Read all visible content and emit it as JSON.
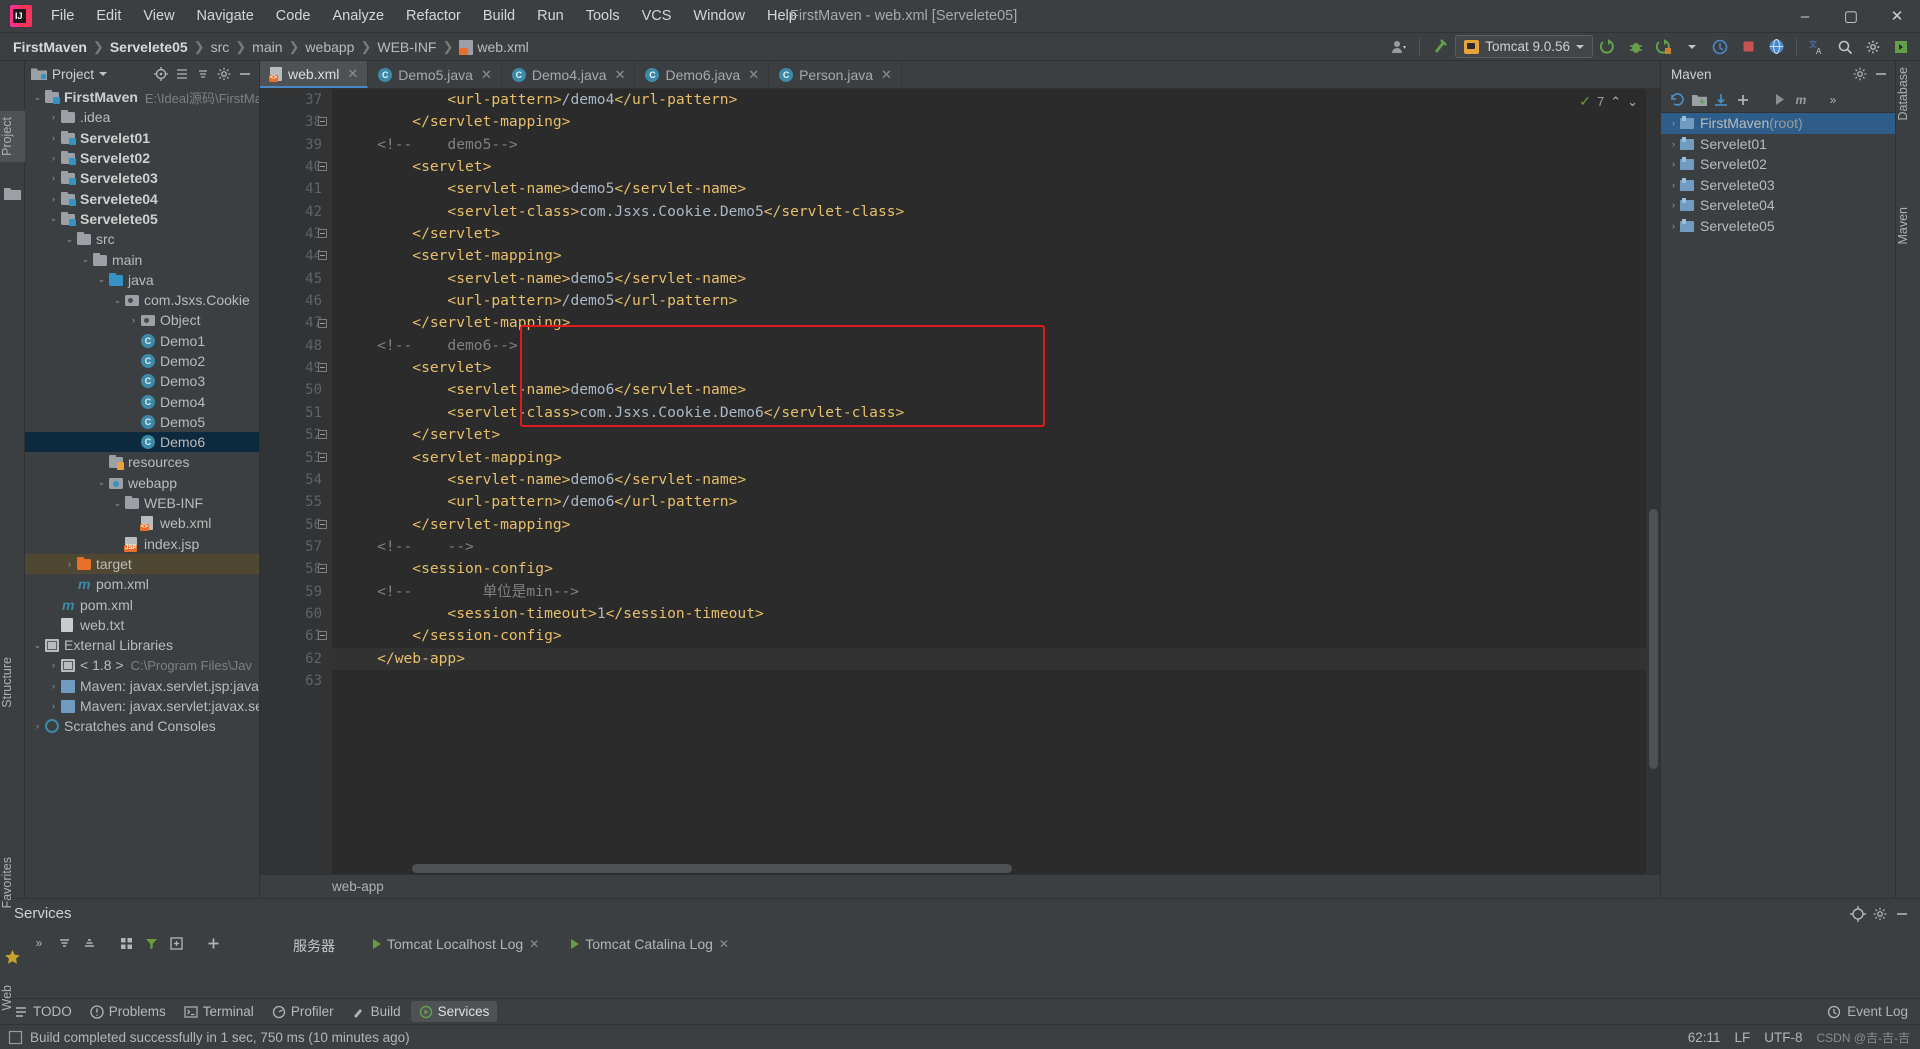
{
  "window": {
    "title": "FirstMaven - web.xml [Servelete05]",
    "minimize": "–",
    "maximize": "▢",
    "close": "✕"
  },
  "menu": {
    "items": [
      "File",
      "Edit",
      "View",
      "Navigate",
      "Code",
      "Analyze",
      "Refactor",
      "Build",
      "Run",
      "Tools",
      "VCS",
      "Window",
      "Help"
    ]
  },
  "navbar": {
    "crumbs": [
      "FirstMaven",
      "Servelete05",
      "src",
      "main",
      "webapp",
      "WEB-INF",
      "web.xml"
    ],
    "run_config": "Tomcat 9.0.56",
    "icons": {
      "profile": "profile-icon",
      "hammer": "build-hammer-icon",
      "run": "run-icon",
      "debug": "debug-icon",
      "run_with_coverage": "coverage-icon",
      "stop": "stop-icon",
      "updates": "updates-icon",
      "translate": "translate-icon",
      "search": "search-icon",
      "settings": "settings-gear-icon",
      "ide_search": "ide-search-icon"
    }
  },
  "left_rail": {
    "top": "Project",
    "middle": "Structure",
    "bottom": "Favorites",
    "web": "Web"
  },
  "right_rail": {
    "top": "Database",
    "bottom": "Maven"
  },
  "project_panel": {
    "title": "Project",
    "actions": [
      "collapse-icon",
      "sort-icon",
      "target-icon",
      "settings-icon",
      "hide-icon"
    ],
    "tree": [
      {
        "depth": 0,
        "arrow": "⌄",
        "icon": "module-folder",
        "label": "FirstMaven",
        "bold": true,
        "sub": "E:\\Ideal源码\\FirstMa"
      },
      {
        "depth": 1,
        "arrow": "›",
        "icon": "folder",
        "label": ".idea",
        "bold": false,
        "sub": ""
      },
      {
        "depth": 1,
        "arrow": "›",
        "icon": "module-folder",
        "label": "Servelet01",
        "bold": true,
        "sub": ""
      },
      {
        "depth": 1,
        "arrow": "›",
        "icon": "module-folder",
        "label": "Servelet02",
        "bold": true,
        "sub": ""
      },
      {
        "depth": 1,
        "arrow": "›",
        "icon": "module-folder",
        "label": "Servelete03",
        "bold": true,
        "sub": ""
      },
      {
        "depth": 1,
        "arrow": "›",
        "icon": "module-folder",
        "label": "Servelete04",
        "bold": true,
        "sub": ""
      },
      {
        "depth": 1,
        "arrow": "⌄",
        "icon": "module-folder",
        "label": "Servelete05",
        "bold": true,
        "sub": ""
      },
      {
        "depth": 2,
        "arrow": "⌄",
        "icon": "folder",
        "label": "src",
        "bold": false,
        "sub": ""
      },
      {
        "depth": 3,
        "arrow": "⌄",
        "icon": "folder",
        "label": "main",
        "bold": false,
        "sub": ""
      },
      {
        "depth": 4,
        "arrow": "⌄",
        "icon": "source-folder",
        "label": "java",
        "bold": false,
        "sub": ""
      },
      {
        "depth": 5,
        "arrow": "⌄",
        "icon": "package",
        "label": "com.Jsxs.Cookie",
        "bold": false,
        "sub": ""
      },
      {
        "depth": 6,
        "arrow": "›",
        "icon": "package",
        "label": "Object",
        "bold": false,
        "sub": ""
      },
      {
        "depth": 6,
        "arrow": "",
        "icon": "class",
        "label": "Demo1",
        "bold": false,
        "sub": ""
      },
      {
        "depth": 6,
        "arrow": "",
        "icon": "class",
        "label": "Demo2",
        "bold": false,
        "sub": ""
      },
      {
        "depth": 6,
        "arrow": "",
        "icon": "class",
        "label": "Demo3",
        "bold": false,
        "sub": ""
      },
      {
        "depth": 6,
        "arrow": "",
        "icon": "class",
        "label": "Demo4",
        "bold": false,
        "sub": ""
      },
      {
        "depth": 6,
        "arrow": "",
        "icon": "class",
        "label": "Demo5",
        "bold": false,
        "sub": ""
      },
      {
        "depth": 6,
        "arrow": "",
        "icon": "class",
        "label": "Demo6",
        "bold": false,
        "sub": "",
        "state": "selected"
      },
      {
        "depth": 4,
        "arrow": "",
        "icon": "resources-folder",
        "label": "resources",
        "bold": false,
        "sub": ""
      },
      {
        "depth": 4,
        "arrow": "⌄",
        "icon": "web-folder",
        "label": "webapp",
        "bold": false,
        "sub": ""
      },
      {
        "depth": 5,
        "arrow": "⌄",
        "icon": "folder",
        "label": "WEB-INF",
        "bold": false,
        "sub": ""
      },
      {
        "depth": 6,
        "arrow": "",
        "icon": "xml-file",
        "label": "web.xml",
        "bold": false,
        "sub": ""
      },
      {
        "depth": 5,
        "arrow": "",
        "icon": "jsp-file",
        "label": "index.jsp",
        "bold": false,
        "sub": ""
      },
      {
        "depth": 2,
        "arrow": "›",
        "icon": "excluded-folder",
        "label": "target",
        "bold": false,
        "sub": "",
        "state": "target-hl"
      },
      {
        "depth": 2,
        "arrow": "",
        "icon": "maven-file",
        "label": "pom.xml",
        "bold": false,
        "sub": ""
      },
      {
        "depth": 1,
        "arrow": "",
        "icon": "maven-file",
        "label": "pom.xml",
        "bold": false,
        "sub": ""
      },
      {
        "depth": 1,
        "arrow": "",
        "icon": "text-file",
        "label": "web.txt",
        "bold": false,
        "sub": ""
      },
      {
        "depth": 0,
        "arrow": "⌄",
        "icon": "library",
        "label": "External Libraries",
        "bold": false,
        "sub": ""
      },
      {
        "depth": 1,
        "arrow": "›",
        "icon": "jdk",
        "label": "< 1.8 >",
        "bold": false,
        "sub": "C:\\Program Files\\Jav"
      },
      {
        "depth": 1,
        "arrow": "›",
        "icon": "jar",
        "label": "Maven: javax.servlet.jsp:javax",
        "bold": false,
        "sub": ""
      },
      {
        "depth": 1,
        "arrow": "›",
        "icon": "jar",
        "label": "Maven: javax.servlet:javax.ser",
        "bold": false,
        "sub": ""
      },
      {
        "depth": 0,
        "arrow": "›",
        "icon": "scratches",
        "label": "Scratches and Consoles",
        "bold": false,
        "sub": ""
      }
    ]
  },
  "editor": {
    "tabs": [
      {
        "label": "web.xml",
        "icon": "xml-file-icon",
        "active": true
      },
      {
        "label": "Demo5.java",
        "icon": "java-class-icon",
        "active": false
      },
      {
        "label": "Demo4.java",
        "icon": "java-class-icon",
        "active": false
      },
      {
        "label": "Demo6.java",
        "icon": "java-class-icon",
        "active": false
      },
      {
        "label": "Person.java",
        "icon": "java-class-icon",
        "active": false
      }
    ],
    "inspection": {
      "warnings": "7",
      "check": "✓"
    },
    "first_line_number": 37,
    "lines": [
      {
        "n": 37,
        "indent": 0,
        "segs": [
          {
            "c": "t",
            "s": "            <url-pattern>"
          },
          {
            "c": "v",
            "s": "/demo4"
          },
          {
            "c": "t",
            "s": "</url-pattern>"
          }
        ]
      },
      {
        "n": 38,
        "indent": 0,
        "segs": [
          {
            "c": "t",
            "s": "        </servlet-mapping>"
          }
        ]
      },
      {
        "n": 39,
        "indent": 0,
        "segs": [
          {
            "c": "cm",
            "s": "    <!--    demo5-->"
          }
        ]
      },
      {
        "n": 40,
        "indent": 0,
        "segs": [
          {
            "c": "t",
            "s": "        <servlet>"
          }
        ]
      },
      {
        "n": 41,
        "indent": 0,
        "segs": [
          {
            "c": "t",
            "s": "            <servlet-name>"
          },
          {
            "c": "v",
            "s": "demo5"
          },
          {
            "c": "t",
            "s": "</servlet-name>"
          }
        ]
      },
      {
        "n": 42,
        "indent": 0,
        "segs": [
          {
            "c": "t",
            "s": "            <servlet-class>"
          },
          {
            "c": "v",
            "s": "com.Jsxs.Cookie.Demo5"
          },
          {
            "c": "t",
            "s": "</servlet-class>"
          }
        ]
      },
      {
        "n": 43,
        "indent": 0,
        "segs": [
          {
            "c": "t",
            "s": "        </servlet>"
          }
        ]
      },
      {
        "n": 44,
        "indent": 0,
        "segs": [
          {
            "c": "t",
            "s": "        <servlet-mapping>"
          }
        ]
      },
      {
        "n": 45,
        "indent": 0,
        "segs": [
          {
            "c": "t",
            "s": "            <servlet-name>"
          },
          {
            "c": "v",
            "s": "demo5"
          },
          {
            "c": "t",
            "s": "</servlet-name>"
          }
        ]
      },
      {
        "n": 46,
        "indent": 0,
        "segs": [
          {
            "c": "t",
            "s": "            <url-pattern>"
          },
          {
            "c": "v",
            "s": "/demo5"
          },
          {
            "c": "t",
            "s": "</url-pattern>"
          }
        ]
      },
      {
        "n": 47,
        "indent": 0,
        "segs": [
          {
            "c": "t",
            "s": "        </servlet-mapping>"
          }
        ]
      },
      {
        "n": 48,
        "indent": 0,
        "segs": [
          {
            "c": "cm",
            "s": "    <!--    demo6-->"
          }
        ]
      },
      {
        "n": 49,
        "indent": 0,
        "segs": [
          {
            "c": "t",
            "s": "        <servlet>"
          }
        ]
      },
      {
        "n": 50,
        "indent": 0,
        "segs": [
          {
            "c": "t",
            "s": "            <servlet-name>"
          },
          {
            "c": "v",
            "s": "demo6"
          },
          {
            "c": "t",
            "s": "</servlet-name>"
          }
        ]
      },
      {
        "n": 51,
        "indent": 0,
        "segs": [
          {
            "c": "t",
            "s": "            <servlet-class>"
          },
          {
            "c": "v",
            "s": "com.Jsxs.Cookie.Demo6"
          },
          {
            "c": "t",
            "s": "</servlet-class>"
          }
        ]
      },
      {
        "n": 52,
        "indent": 0,
        "segs": [
          {
            "c": "t",
            "s": "        </servlet>"
          }
        ]
      },
      {
        "n": 53,
        "indent": 0,
        "segs": [
          {
            "c": "t",
            "s": "        <servlet-mapping>"
          }
        ]
      },
      {
        "n": 54,
        "indent": 0,
        "segs": [
          {
            "c": "t",
            "s": "            <servlet-name>"
          },
          {
            "c": "v",
            "s": "demo6"
          },
          {
            "c": "t",
            "s": "</servlet-name>"
          }
        ]
      },
      {
        "n": 55,
        "indent": 0,
        "segs": [
          {
            "c": "t",
            "s": "            <url-pattern>"
          },
          {
            "c": "v",
            "s": "/demo6"
          },
          {
            "c": "t",
            "s": "</url-pattern>"
          }
        ]
      },
      {
        "n": 56,
        "indent": 0,
        "segs": [
          {
            "c": "t",
            "s": "        </servlet-mapping>"
          }
        ]
      },
      {
        "n": 57,
        "indent": 0,
        "segs": [
          {
            "c": "cm",
            "s": "    <!--    -->"
          }
        ]
      },
      {
        "n": 58,
        "indent": 0,
        "segs": [
          {
            "c": "t",
            "s": "        <session-config>"
          }
        ]
      },
      {
        "n": 59,
        "indent": 0,
        "segs": [
          {
            "c": "cm",
            "s": "    <!--        单位是min-->"
          }
        ]
      },
      {
        "n": 60,
        "indent": 0,
        "segs": [
          {
            "c": "t",
            "s": "            <session-timeout>"
          },
          {
            "c": "v",
            "s": "1"
          },
          {
            "c": "t",
            "s": "</session-timeout>"
          }
        ]
      },
      {
        "n": 61,
        "indent": 0,
        "segs": [
          {
            "c": "t",
            "s": "        </session-config>"
          }
        ]
      },
      {
        "n": 62,
        "indent": 0,
        "current": true,
        "segs": [
          {
            "c": "t",
            "s": "    </web-app>"
          }
        ]
      },
      {
        "n": 63,
        "indent": 0,
        "segs": []
      }
    ],
    "breadcrumb": "web-app",
    "highlight_box_label": "session-config-highlight"
  },
  "maven_panel": {
    "title": "Maven",
    "toolbar": [
      "refresh-icon",
      "add-folder-icon",
      "download-icon",
      "add-icon",
      "run-icon",
      "toggle-icon",
      "expand-icon"
    ],
    "items": [
      {
        "label": "FirstMaven",
        "suffix": " (root)",
        "selected": true
      },
      {
        "label": "Servelet01",
        "suffix": "",
        "selected": false
      },
      {
        "label": "Servelet02",
        "suffix": "",
        "selected": false
      },
      {
        "label": "Servelete03",
        "suffix": "",
        "selected": false
      },
      {
        "label": "Servelete04",
        "suffix": "",
        "selected": false
      },
      {
        "label": "Servelete05",
        "suffix": "",
        "selected": false
      }
    ]
  },
  "services": {
    "title": "Services",
    "toolbar_icons": [
      "collapse-all-icon",
      "expand-all-icon",
      "group-icon",
      "filter-icon",
      "add-frame-icon",
      "plus-icon"
    ],
    "tabs": [
      {
        "label": "服务器",
        "closable": false,
        "icon": ""
      },
      {
        "label": "Tomcat Localhost Log",
        "closable": true,
        "icon": "run-icon"
      },
      {
        "label": "Tomcat Catalina Log",
        "closable": true,
        "icon": "run-icon"
      }
    ],
    "right_actions": [
      "locate-icon",
      "settings-icon",
      "hide-icon"
    ]
  },
  "tool_windows": {
    "items": [
      {
        "label": "TODO",
        "icon": "todo-icon",
        "active": false
      },
      {
        "label": "Problems",
        "icon": "problems-icon",
        "active": false
      },
      {
        "label": "Terminal",
        "icon": "terminal-icon",
        "active": false
      },
      {
        "label": "Profiler",
        "icon": "profiler-icon",
        "active": false
      },
      {
        "label": "Build",
        "icon": "build-icon",
        "active": false
      },
      {
        "label": "Services",
        "icon": "services-icon",
        "active": true
      }
    ],
    "event_log": "Event Log"
  },
  "statusbar": {
    "message": "Build completed successfully in 1 sec, 750 ms (10 minutes ago)",
    "caret": "62:11",
    "line_sep": "LF",
    "encoding": "UTF-8",
    "watermark": "CSDN @吉-吉-吉"
  }
}
